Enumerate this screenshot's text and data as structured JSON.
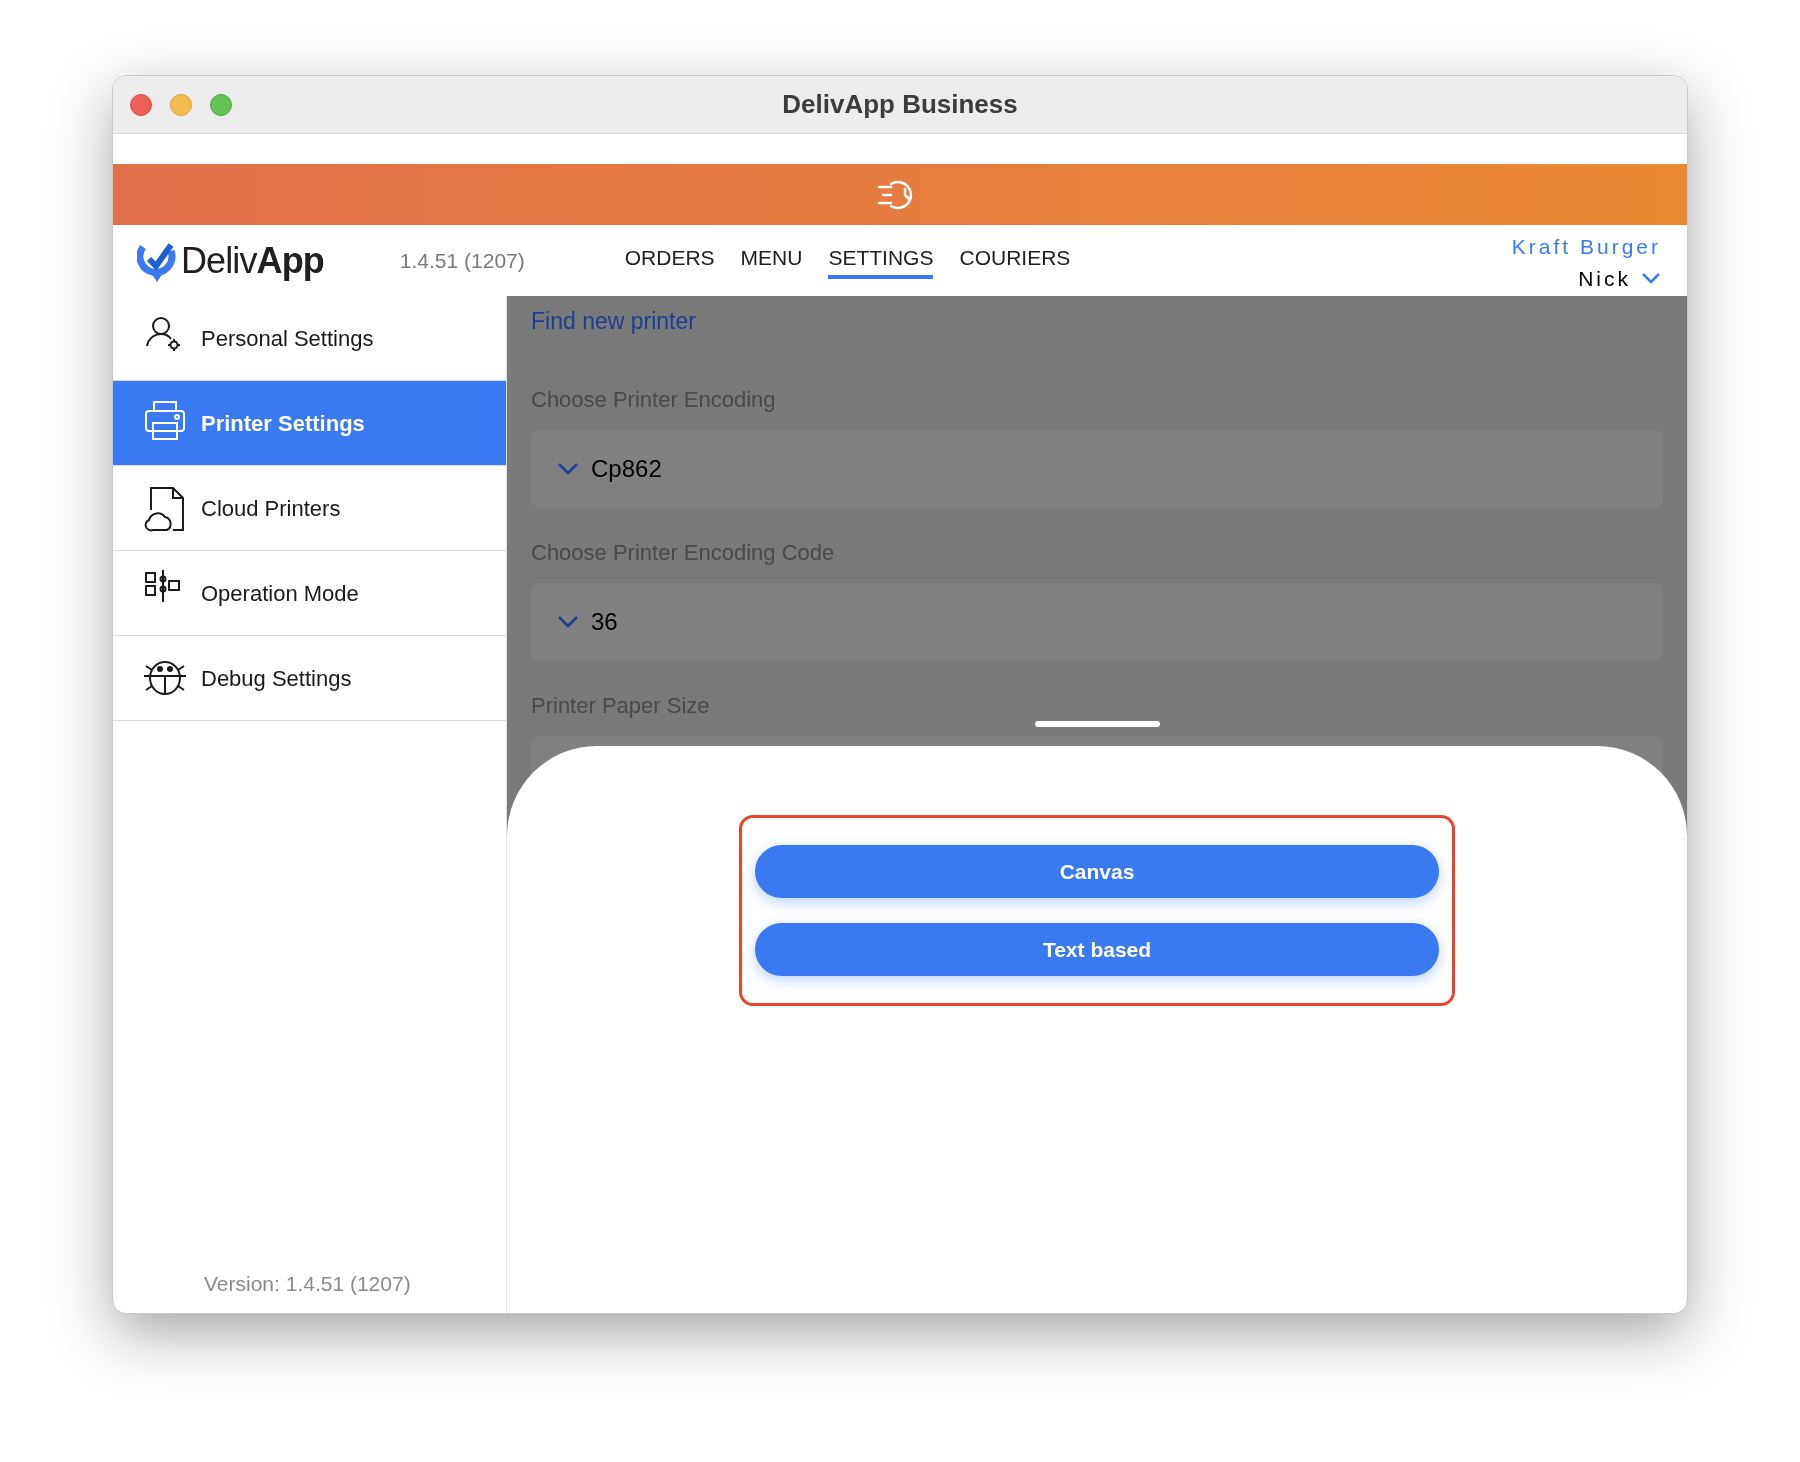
{
  "window": {
    "title": "DelivApp Business"
  },
  "header": {
    "logo_light": "Deliv",
    "logo_bold": "App",
    "version": "1.4.51 (1207)",
    "nav": [
      {
        "label": "ORDERS",
        "selected": false
      },
      {
        "label": "MENU",
        "selected": false
      },
      {
        "label": "SETTINGS",
        "selected": true
      },
      {
        "label": "COURIERS",
        "selected": false
      }
    ],
    "account": {
      "business": "Kraft Burger",
      "user": "Nick"
    }
  },
  "sidebar": {
    "items": [
      {
        "label": "Personal Settings",
        "kind": "person",
        "selected": false
      },
      {
        "label": "Printer Settings",
        "kind": "printer",
        "selected": true
      },
      {
        "label": "Cloud Printers",
        "kind": "cloud",
        "selected": false
      },
      {
        "label": "Operation Mode",
        "kind": "mode",
        "selected": false
      },
      {
        "label": "Debug Settings",
        "kind": "bug",
        "selected": false
      }
    ],
    "version": "Version: 1.4.51 (1207)"
  },
  "content": {
    "link": "Find new printer",
    "fields": [
      {
        "label": "Choose Printer Encoding",
        "value": "Cp862"
      },
      {
        "label": "Choose Printer Encoding Code",
        "value": "36"
      },
      {
        "label": "Printer Paper Size"
      }
    ]
  },
  "sheet": {
    "options": [
      "Canvas",
      "Text based"
    ]
  }
}
